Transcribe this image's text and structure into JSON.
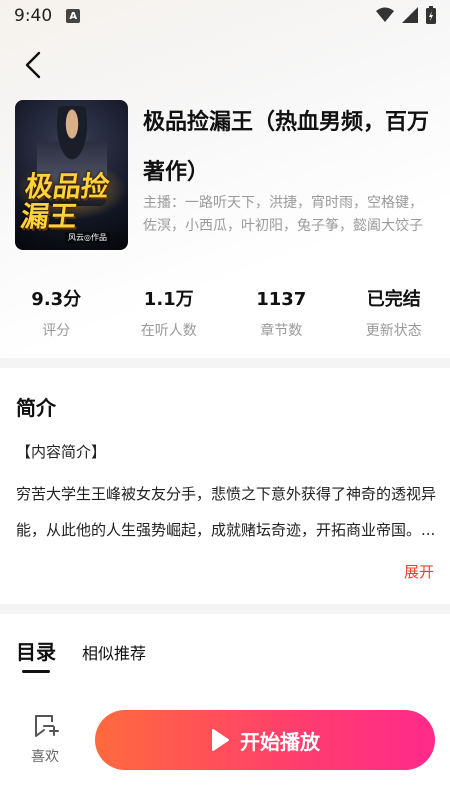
{
  "status_bar": {
    "time": "9:40",
    "notif_letter": "A"
  },
  "book": {
    "title": "极品捡漏王（热血男频，百万著作）",
    "cast": "主播：一路听天下，洪捷，宵时雨，空格键，佐溟，小西瓜，叶初阳，兔子筝，懿阖大饺子",
    "cover_title": "极品捡漏王",
    "cover_author": "风云◎作品"
  },
  "stats": [
    {
      "value": "9.3分",
      "label": "评分"
    },
    {
      "value": "1.1万",
      "label": "在听人数"
    },
    {
      "value": "1137",
      "label": "章节数"
    },
    {
      "value": "已完结",
      "label": "更新状态"
    }
  ],
  "intro": {
    "title": "简介",
    "head": "【内容简介】",
    "text": "穷苦大学生王峰被女友分手，悲愤之下意外获得了神奇的透视异能，从此他的人生强势崛起，成就赌坛奇迹，开拓商业帝国。...",
    "expand": "展开"
  },
  "tabs": {
    "catalog": "目录",
    "similar": "相似推荐"
  },
  "bottom": {
    "fav_label": "喜欢",
    "play_label": "开始播放"
  },
  "colors": {
    "accent_red": "#ff3b30",
    "play_start": "#ff6a3d",
    "play_end": "#ff2a8a"
  }
}
